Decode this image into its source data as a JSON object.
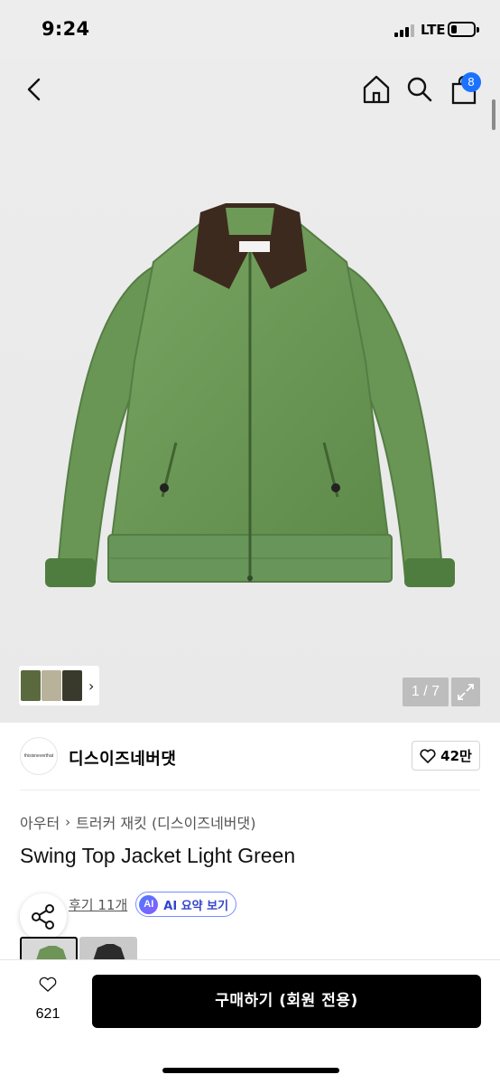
{
  "status_bar": {
    "time": "9:24",
    "network": "LTE",
    "battery_level": 0.25
  },
  "header": {
    "cart_count": "8"
  },
  "gallery": {
    "page_indicator": "1 / 7",
    "thumbnail_colors": [
      "#5a6a3e",
      "#b8b29a",
      "#3a3a2c"
    ]
  },
  "brand": {
    "logo_text": "thisisneverthat",
    "name": "디스이즈네버댓",
    "likes": "42만"
  },
  "breadcrumb": {
    "category": "아우터",
    "subcategory": "트러커 재킷 (디스이즈네버댓)"
  },
  "product": {
    "title": "Swing Top Jacket Light Green",
    "reviews": "후기 11개",
    "ai_badge": "AI",
    "ai_summary": "AI 요약 보기"
  },
  "bottom_bar": {
    "wishlist_count": "621",
    "buy_label": "구매하기 (회원 전용)"
  },
  "colors": {
    "accent_blue": "#1a72ff",
    "jacket_green": "#6e9a58",
    "collar_brown": "#3d2a1e",
    "button_black": "#000000"
  }
}
